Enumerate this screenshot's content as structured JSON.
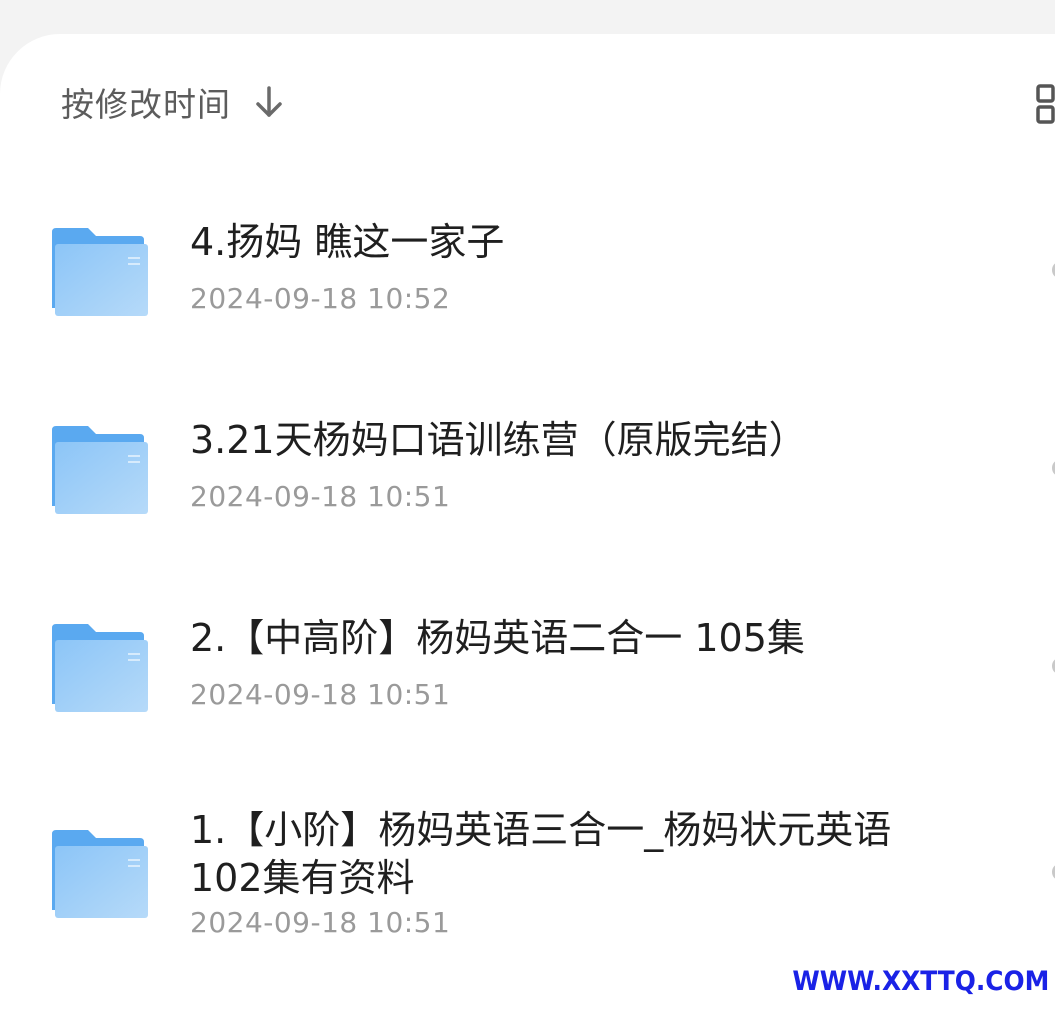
{
  "toolbar": {
    "sort_label": "按修改时间",
    "sort_direction_icon": "arrow-down-icon",
    "view_toggle_icon": "grid-view-icon"
  },
  "files": [
    {
      "name": "4.扬妈 瞧这一家子",
      "modified": "2024-09-18 10:52",
      "type": "folder"
    },
    {
      "name": "3.21天杨妈口语训练营（原版完结）",
      "modified": "2024-09-18 10:51",
      "type": "folder"
    },
    {
      "name": "2.【中高阶】杨妈英语二合一  105集",
      "modified": "2024-09-18 10:51",
      "type": "folder"
    },
    {
      "name": "1.【小阶】杨妈英语三合一_杨妈状元英语102集有资料",
      "modified": "2024-09-18 10:51",
      "type": "folder"
    }
  ],
  "watermark": "WWW.XXTTQ.COM",
  "colors": {
    "folder_back": "#5aa9f0",
    "folder_front_top": "#8cc5f7",
    "folder_front_bottom": "#b6daf9",
    "watermark": "#1a22e6"
  }
}
